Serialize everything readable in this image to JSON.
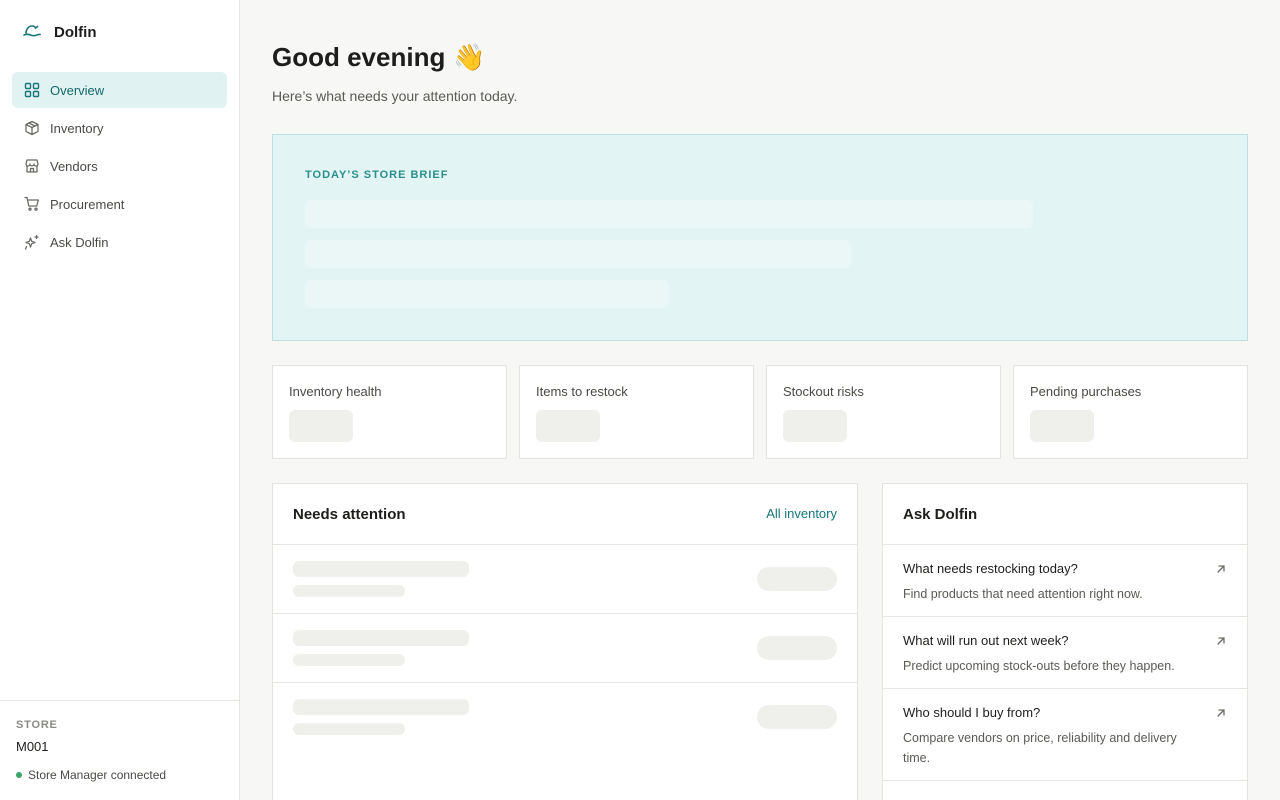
{
  "brand": {
    "name": "Dolfin",
    "logo_icon": "dolfin-logo-icon"
  },
  "nav": {
    "items": [
      {
        "label": "Overview",
        "icon": "grid-icon",
        "active": true
      },
      {
        "label": "Inventory",
        "icon": "box-icon"
      },
      {
        "label": "Vendors",
        "icon": "store-icon"
      },
      {
        "label": "Procurement",
        "icon": "cart-icon"
      },
      {
        "label": "Ask Dolfin",
        "icon": "sparkle-icon"
      }
    ]
  },
  "store": {
    "caption": "STORE",
    "id": "M001",
    "status": "Store Manager connected",
    "status_color": "#3aa36a"
  },
  "header": {
    "greeting": "Good evening",
    "emoji": "👋",
    "subtitle": "Here’s what needs your attention today."
  },
  "brief": {
    "title": "TODAY’S STORE BRIEF"
  },
  "stats": [
    {
      "label": "Inventory health"
    },
    {
      "label": "Items to restock"
    },
    {
      "label": "Stockout risks"
    },
    {
      "label": "Pending purchases"
    }
  ],
  "needs_attention": {
    "title": "Needs attention",
    "link": "All inventory"
  },
  "ask_dolfin": {
    "title": "Ask Dolfin",
    "items": [
      {
        "question": "What needs restocking today?",
        "description": "Find products that need attention right now."
      },
      {
        "question": "What will run out next week?",
        "description": "Predict upcoming stock-outs before they happen."
      },
      {
        "question": "Who should I buy from?",
        "description": "Compare vendors on price, reliability and delivery time."
      }
    ]
  },
  "colors": {
    "accent": "#16767a",
    "active_bg": "#e0f3f2",
    "brief_bg": "#e2f4f3",
    "page_bg": "#f7f7f5"
  }
}
